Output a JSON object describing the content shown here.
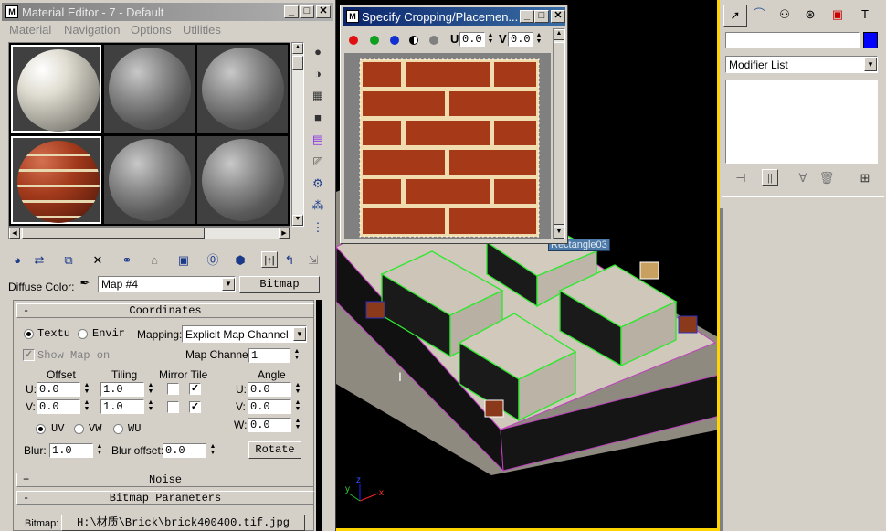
{
  "material_editor": {
    "title": "Material Editor - 7 - Default",
    "menu": [
      "Material",
      "Navigation",
      "Options",
      "Utilities"
    ],
    "diffuse_label": "Diffuse Color:",
    "map_name": "Map #4",
    "map_type_button": "Bitmap",
    "coordinates": {
      "header": "Coordinates",
      "texture_radio": "Textu",
      "environ_radio": "Envir",
      "mapping_label": "Mapping:",
      "mapping_value": "Explicit Map Channel",
      "show_map_label": "Show Map on",
      "map_channel_label": "Map Channel:",
      "map_channel_value": "1",
      "offset_label": "Offset",
      "tiling_label": "Tiling",
      "mirror_tile_label": "Mirror Tile",
      "angle_label": "Angle",
      "u_label": "U:",
      "v_label": "V:",
      "w_label": "W:",
      "offset_u": "0.0",
      "offset_v": "0.0",
      "tiling_u": "1.0",
      "tiling_v": "1.0",
      "angle_u": "0.0",
      "angle_v": "0.0",
      "angle_w": "0.0",
      "uv_radio": "UV",
      "vw_radio": "VW",
      "wu_radio": "WU",
      "blur_label": "Blur:",
      "blur_value": "1.0",
      "blur_offset_label": "Blur offset:",
      "blur_offset_value": "0.0",
      "rotate_button": "Rotate"
    },
    "noise_header": "Noise",
    "bitmap_params_header": "Bitmap Parameters",
    "bitmap_label": "Bitmap:",
    "bitmap_path": "H:\\材质\\Brick\\brick400400.tif.jpg"
  },
  "crop_dialog": {
    "title": "Specify Cropping/Placemen...",
    "u_label": "U",
    "u_value": "0.0",
    "v_label": "V",
    "v_value": "0.0",
    "colors": {
      "red": "#e01010",
      "green": "#10a020",
      "blue": "#1030d0"
    }
  },
  "viewport": {
    "object_tooltip": "Rectangle03",
    "axis_x": "x",
    "axis_y": "y",
    "axis_z": "z"
  },
  "command_panel": {
    "modifier_list": "Modifier List",
    "object_color": "#0000ff",
    "tabs": [
      "create-icon",
      "modify-icon",
      "hierarchy-icon",
      "motion-icon",
      "display-icon",
      "utilities-icon"
    ]
  }
}
